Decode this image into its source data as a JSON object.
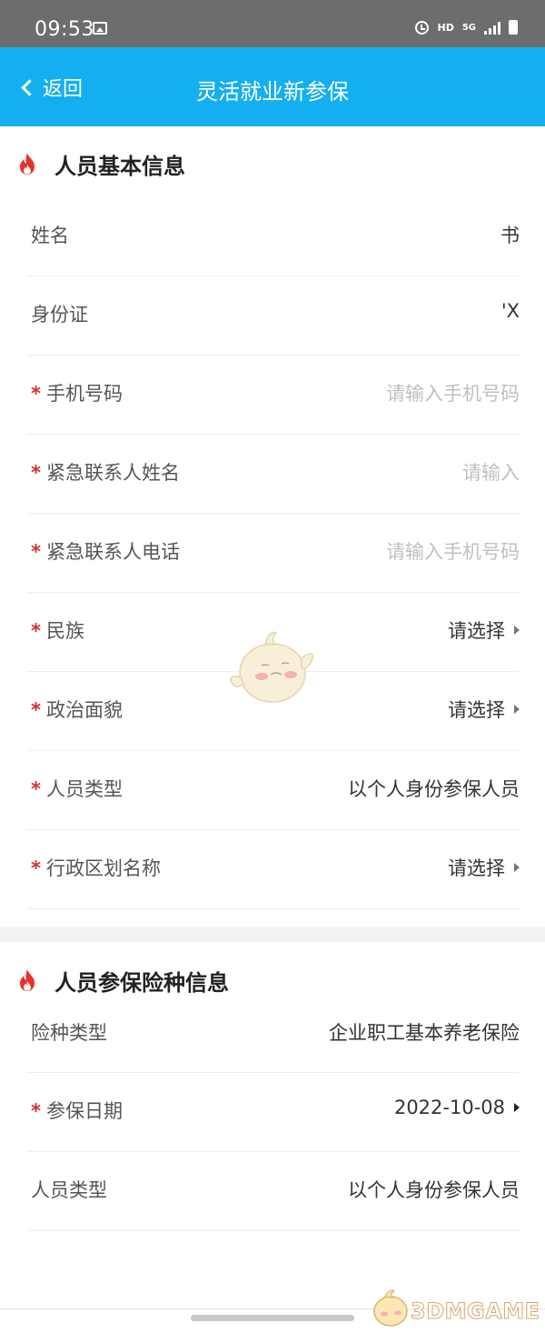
{
  "status_bar": {
    "time": "09:53",
    "hd": "HD",
    "net": "5G"
  },
  "nav": {
    "back_label": "返回",
    "title": "灵活就业新参保"
  },
  "basic_info": {
    "title": "人员基本信息",
    "rows": [
      {
        "label": "姓名",
        "value": "书"
      },
      {
        "label": "身份证",
        "value": "'X"
      },
      {
        "label": "手机号码",
        "required": "*",
        "placeholder": "请输入手机号码"
      },
      {
        "label": "紧急联系人姓名",
        "required": "*",
        "placeholder": "请输入"
      },
      {
        "label": "紧急联系人电话",
        "required": "*",
        "placeholder": "请输入手机号码"
      },
      {
        "label": "民族",
        "required": "*",
        "select": "请选择"
      },
      {
        "label": "政治面貌",
        "required": "*",
        "select": "请选择"
      },
      {
        "label": "人员类型",
        "required": "*",
        "value": "以个人身份参保人员"
      },
      {
        "label": "行政区划名称",
        "required": "*",
        "select": "请选择"
      }
    ]
  },
  "insurance_info": {
    "title": "人员参保险种信息",
    "rows": [
      {
        "label": "险种类型",
        "value": "企业职工基本养老保险"
      },
      {
        "label": "参保日期",
        "required": "*",
        "select": "2022-10-08"
      },
      {
        "label": "人员类型",
        "value": "以个人身份参保人员"
      }
    ]
  },
  "watermark": {
    "text": "3DMGAME"
  },
  "colors": {
    "nav_bg": "#14aff0",
    "status_bg": "#6d6d6d",
    "required": "#d43030",
    "fire": "#e8302a"
  }
}
